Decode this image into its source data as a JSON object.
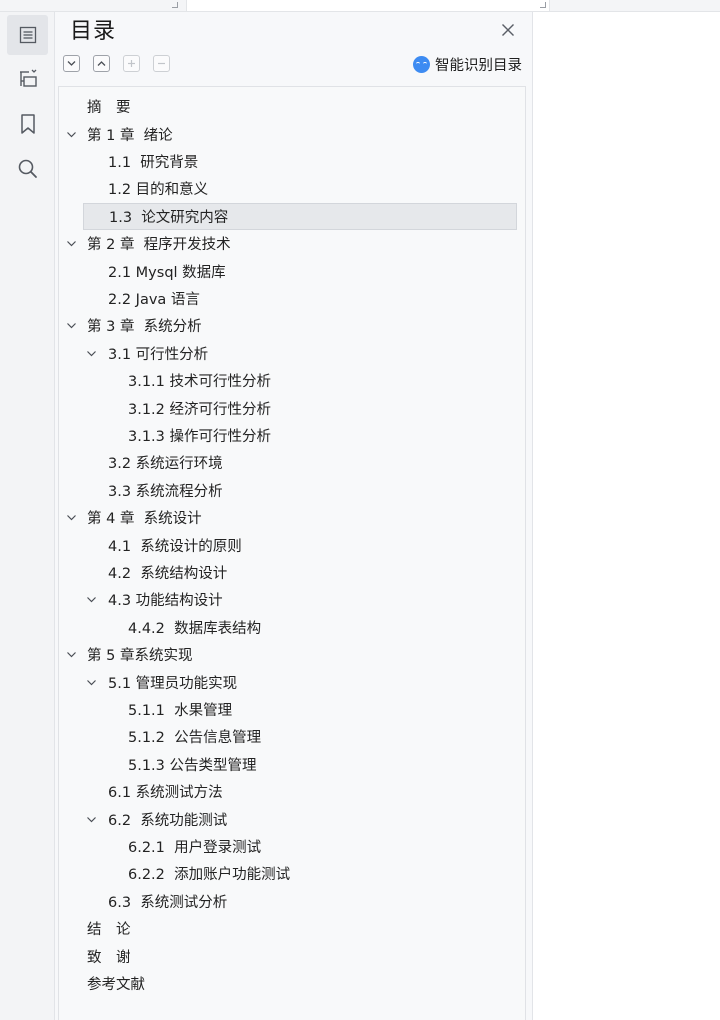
{
  "panel": {
    "title": "目录",
    "ai_label": "智能识别目录"
  },
  "rail": {
    "items": [
      {
        "icon": "toc-icon",
        "active": true
      },
      {
        "icon": "outline-tree-icon",
        "active": false
      },
      {
        "icon": "bookmark-icon",
        "active": false
      },
      {
        "icon": "search-icon",
        "active": false
      }
    ]
  },
  "toolbar": {
    "buttons": [
      {
        "icon": "collapse-all-icon",
        "enabled": true
      },
      {
        "icon": "expand-all-icon",
        "enabled": true
      },
      {
        "icon": "add-heading-icon",
        "enabled": false
      },
      {
        "icon": "remove-heading-icon",
        "enabled": false
      }
    ]
  },
  "toc": [
    {
      "label": "摘　要",
      "level": 0,
      "expander": false,
      "selected": false
    },
    {
      "label": "第 1 章  绪论",
      "level": 0,
      "expander": true,
      "selected": false
    },
    {
      "label": "1.1  研究背景",
      "level": 1,
      "expander": false,
      "selected": false
    },
    {
      "label": "1.2 目的和意义",
      "level": 1,
      "expander": false,
      "selected": false
    },
    {
      "label": "1.3  论文研究内容",
      "level": 1,
      "expander": false,
      "selected": true
    },
    {
      "label": "第 2 章  程序开发技术",
      "level": 0,
      "expander": true,
      "selected": false
    },
    {
      "label": "2.1 Mysql 数据库",
      "level": 1,
      "expander": false,
      "selected": false
    },
    {
      "label": "2.2 Java 语言",
      "level": 1,
      "expander": false,
      "selected": false
    },
    {
      "label": "第 3 章  系统分析",
      "level": 0,
      "expander": true,
      "selected": false
    },
    {
      "label": "3.1 可行性分析",
      "level": 1,
      "expander": true,
      "selected": false
    },
    {
      "label": "3.1.1 技术可行性分析",
      "level": 2,
      "expander": false,
      "selected": false
    },
    {
      "label": "3.1.2 经济可行性分析",
      "level": 2,
      "expander": false,
      "selected": false
    },
    {
      "label": "3.1.3 操作可行性分析",
      "level": 2,
      "expander": false,
      "selected": false
    },
    {
      "label": "3.2 系统运行环境",
      "level": 1,
      "expander": false,
      "selected": false
    },
    {
      "label": "3.3 系统流程分析",
      "level": 1,
      "expander": false,
      "selected": false
    },
    {
      "label": "第 4 章  系统设计",
      "level": 0,
      "expander": true,
      "selected": false
    },
    {
      "label": "4.1  系统设计的原则",
      "level": 1,
      "expander": false,
      "selected": false
    },
    {
      "label": "4.2  系统结构设计",
      "level": 1,
      "expander": false,
      "selected": false
    },
    {
      "label": "4.3 功能结构设计",
      "level": 1,
      "expander": true,
      "selected": false
    },
    {
      "label": "4.4.2  数据库表结构",
      "level": 2,
      "expander": false,
      "selected": false
    },
    {
      "label": "第 5 章系统实现",
      "level": 0,
      "expander": true,
      "selected": false
    },
    {
      "label": "5.1 管理员功能实现",
      "level": 1,
      "expander": true,
      "selected": false
    },
    {
      "label": "5.1.1  水果管理",
      "level": 2,
      "expander": false,
      "selected": false
    },
    {
      "label": "5.1.2  公告信息管理",
      "level": 2,
      "expander": false,
      "selected": false
    },
    {
      "label": "5.1.3 公告类型管理",
      "level": 2,
      "expander": false,
      "selected": false
    },
    {
      "label": "6.1 系统测试方法",
      "level": 1,
      "expander": false,
      "selected": false
    },
    {
      "label": "6.2  系统功能测试",
      "level": 1,
      "expander": true,
      "selected": false
    },
    {
      "label": "6.2.1  用户登录测试",
      "level": 2,
      "expander": false,
      "selected": false
    },
    {
      "label": "6.2.2  添加账户功能测试",
      "level": 2,
      "expander": false,
      "selected": false
    },
    {
      "label": "6.3  系统测试分析",
      "level": 1,
      "expander": false,
      "selected": false
    },
    {
      "label": "结　论",
      "level": 0,
      "expander": false,
      "selected": false
    },
    {
      "label": "致　谢",
      "level": 0,
      "expander": false,
      "selected": false
    },
    {
      "label": "参考文献",
      "level": 0,
      "expander": false,
      "selected": false
    }
  ]
}
